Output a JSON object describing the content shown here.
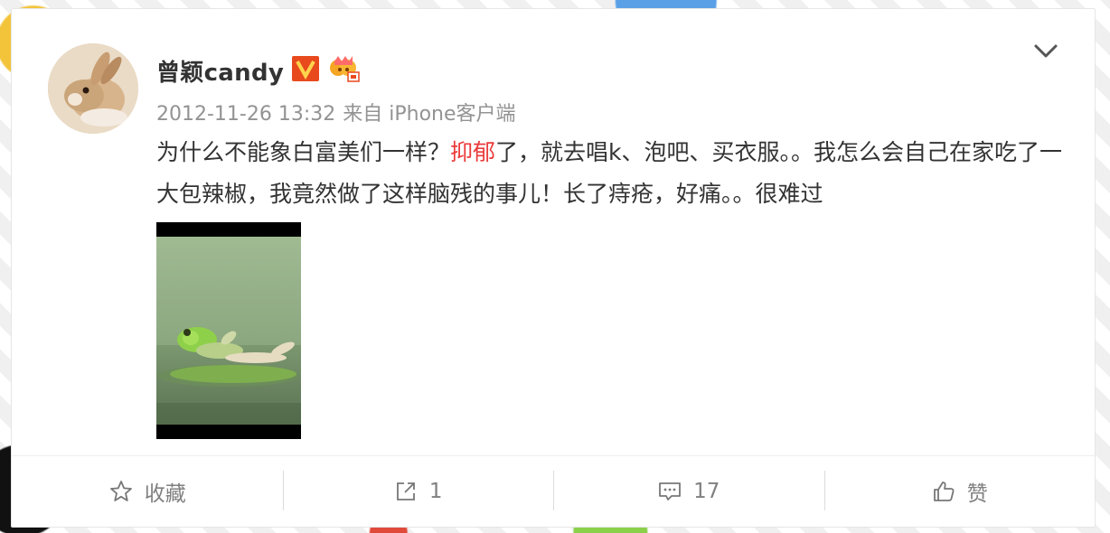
{
  "post": {
    "username": "曾颖candy",
    "timestamp": "2012-11-26 13:32",
    "source": "来自 iPhone客户端",
    "text_before_topic": "为什么不能象白富美们一样？",
    "topic": "抑郁",
    "text_after_topic": "了，就去唱k、泡吧、买衣服。。我怎么会自己在家吃了一大包辣椒，我竟然做了这样脑残的事儿！长了痔疮，好痛。。很难过",
    "badges": [
      "verified-v-icon",
      "member-crown-icon"
    ],
    "image": "frog-lounging-on-lily-pad-photo"
  },
  "actions": {
    "favorite_label": "收藏",
    "share_count": "1",
    "comment_count": "17",
    "like_label": "赞"
  },
  "colors": {
    "topic": "#eb3b3b",
    "verified": "#e8491d",
    "meta": "#939393",
    "action": "#808080"
  }
}
